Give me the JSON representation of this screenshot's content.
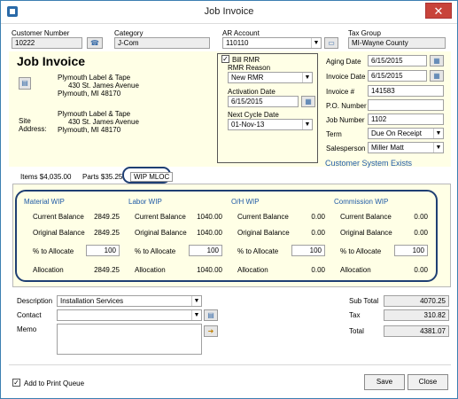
{
  "window": {
    "title": "Job Invoice",
    "close": "✕"
  },
  "header": {
    "customer_number_label": "Customer Number",
    "customer_number": "10222",
    "category_label": "Category",
    "category": "J-Com",
    "ar_account_label": "AR Account",
    "ar_account": "110110",
    "tax_group_label": "Tax Group",
    "tax_group": "MI-Wayne County"
  },
  "invoice": {
    "heading": "Job Invoice",
    "bill_to": [
      "Plymouth Label & Tape",
      "430 St. James Avenue",
      "Plymouth, MI  48170"
    ],
    "site_label_1": "Site",
    "site_label_2": "Address:",
    "site_address": [
      "Plymouth Label & Tape",
      "430 St. James Avenue",
      "Plymouth, MI  48170"
    ]
  },
  "rmr": {
    "bill_label": "Bill RMR",
    "reason_label": "RMR Reason",
    "reason": "New RMR",
    "activation_label": "Activation Date",
    "activation": "6/15/2015",
    "cycle_label": "Next Cycle Date",
    "cycle": "01-Nov-13"
  },
  "right": {
    "aging_label": "Aging Date",
    "aging": "6/15/2015",
    "invoice_date_label": "Invoice Date",
    "invoice_date": "6/15/2015",
    "invoice_num_label": "Invoice #",
    "invoice_num": "141583",
    "po_label": "P.O. Number",
    "po": "",
    "job_label": "Job Number",
    "job": "1102",
    "term_label": "Term",
    "term": "Due On Receipt",
    "sales_label": "Salesperson",
    "sales": "Miller Matt",
    "system_exists": "Customer System Exists"
  },
  "tabs": {
    "items": "Items",
    "items_amt": "$4,035.00",
    "parts": "Parts",
    "parts_amt": "$35.25",
    "wip": "WIP MLOC"
  },
  "wip": {
    "cur_label": "Current Balance",
    "orig_label": "Original Balance",
    "pct_label": "% to Allocate",
    "alloc_label": "Allocation",
    "material": {
      "title": "Material WIP",
      "cur": "2849.25",
      "orig": "2849.25",
      "pct": "100",
      "alloc": "2849.25"
    },
    "labor": {
      "title": "Labor WIP",
      "cur": "1040.00",
      "orig": "1040.00",
      "pct": "100",
      "alloc": "1040.00"
    },
    "oh": {
      "title": "O/H WIP",
      "cur": "0.00",
      "orig": "0.00",
      "pct": "100",
      "alloc": "0.00"
    },
    "commission": {
      "title": "Commission WIP",
      "cur": "0.00",
      "orig": "0.00",
      "pct": "100",
      "alloc": "0.00"
    }
  },
  "bottom": {
    "description_label": "Description",
    "description": "Installation Services",
    "contact_label": "Contact",
    "contact": "",
    "memo_label": "Memo",
    "memo": "",
    "subtotal_label": "Sub Total",
    "subtotal": "4070.25",
    "tax_label": "Tax",
    "tax": "310.82",
    "total_label": "Total",
    "total": "4381.07",
    "print_queue": "Add to Print Queue",
    "save": "Save",
    "close": "Close"
  }
}
